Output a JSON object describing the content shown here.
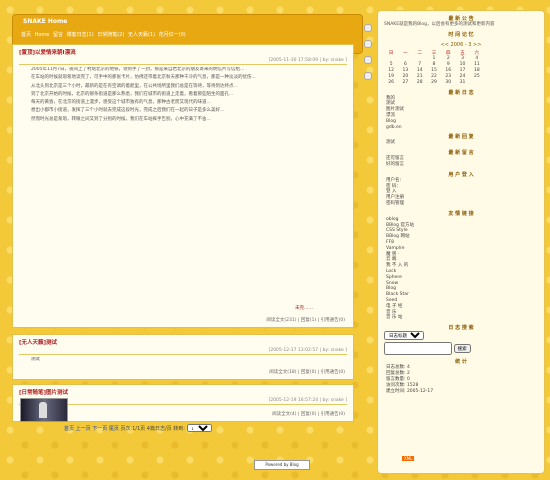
{
  "header": {
    "site_title": "SNAKE Home",
    "nav": [
      "首页",
      "Home",
      "留言",
      "博客日志(1)",
      "日常随笔(2)",
      "无人天籁(1)",
      "花月红一(0)"
    ]
  },
  "posts": [
    {
      "title": "[置顶]以爱情来朝I漂流",
      "meta": "[2005-11-30 17:58:09 | by: snake ]",
      "paragraphs": [
        "2005年11月7日，夜间上了村站北京的地铁，领到手了一封，那是来自岩北京的朋友寄来的明信片写信给...",
        "在车站的时候就匆匆地读完了，可手中的那张卡片，仿佛还带着北京秋天那种干冷的气息，那是一种淡淡的忧伤...",
        "从北头到北京是三个小时，最新的是在有空调的着舱里，在公共场所里我们总是在等待，等待到达终点...",
        "到了北京开始的时候，北京的那条街道是那么熟悉，我们在城市的街道上走着，看着那些陌生的面孔...",
        "每天的黄昏，在北京的街道上漫步，感受这个城市独有的气息，那种古老而又现代的味道...",
        "想出小都市小街道，发挥了三个小时就去完成这段时光，完成之后我们在一起的日子是多么美好...",
        "然而时光总是匆匆，转眼之间又到了分别的时候，我们在车站挥手告别，心中充满了不舍..."
      ],
      "read_more": "未完……",
      "footer": "阅读全文(231) | 回复(1) | 引用通告(0)"
    },
    {
      "title": "[无人天籁]测试",
      "meta": "[2005-12-17 13:02:57 | by: snake ]",
      "paragraphs": [
        "测试"
      ],
      "read_more": "",
      "footer": "阅读全文(18) | 回复(0) | 引用通告(0)"
    },
    {
      "title": "[日常随笔]图片测试",
      "meta": "[2005-12-19 16:57:24 | by: snake ]",
      "paragraphs": [],
      "read_more": "",
      "footer": "阅读全文(4) | 回复(0) | 引用通告(0)"
    }
  ],
  "pager": {
    "label_home": "首页",
    "label_prev": "上一页",
    "label_next": "下一页",
    "label_last": "尾页",
    "info": "页次:1/1页 4篇日志/页 转到:",
    "goto_value": "1"
  },
  "footer_badge": "Powered by Blog",
  "sidebar": {
    "announcement_title": "最 新 公 告",
    "announcement_text": "SNAKE就是我的Blog，以后会有更多的测试和更新内容",
    "calendar_title": "时 间 记 忆",
    "calendar_month": "<< 2006 - 3 >>",
    "calendar_head": [
      "日",
      "一",
      "二",
      "三",
      "四",
      "五",
      "六"
    ],
    "calendar_rows": [
      [
        "",
        "",
        "",
        "1",
        "2",
        "3",
        "4"
      ],
      [
        "5",
        "6",
        "7",
        "8",
        "9",
        "10",
        "11"
      ],
      [
        "12",
        "13",
        "14",
        "15",
        "16",
        "17",
        "18"
      ],
      [
        "19",
        "20",
        "21",
        "22",
        "23",
        "24",
        "25"
      ],
      [
        "26",
        "27",
        "28",
        "29",
        "30",
        "31",
        ""
      ]
    ],
    "categories_title": "最 新 日 志",
    "categories": [
      "我的",
      "测试",
      "图片测试",
      "漂流",
      "Blog",
      "gdb.en"
    ],
    "comments_title": "最 新 回 复",
    "comments": [
      "测试"
    ],
    "guestbook_title": "最 新 留 言",
    "guestbook": [
      "还可留言",
      "好的留言"
    ],
    "user_title": "用 户 登 入",
    "user_items": [
      "用户名：",
      "密 码：",
      "登 入",
      "用户注册",
      "密码管理"
    ],
    "links_title": "友 情 链 接",
    "links": [
      "oblog",
      "BBlog 官方站",
      "CSS Style",
      "BBlog 网站",
      "FF8",
      "Vamplre",
      "魔 兽 ·",
      "云 端",
      "我 不 入 的",
      "Lock",
      "Sphere",
      "Snow",
      "Blog",
      "Black Star",
      "Seed",
      "电 子 经",
      "音 乐",
      "音 乐 站"
    ],
    "search_title": "日 志 搜 索",
    "search_option": "日志标题",
    "search_button": "搜索",
    "stats_title": "统 计",
    "stats": [
      "日志总数: 4",
      "回复总数: 2",
      "留言数量: 0",
      "访问次数: 1528",
      "建立时间: 2005-12-17"
    ],
    "xml_label": "XML"
  }
}
